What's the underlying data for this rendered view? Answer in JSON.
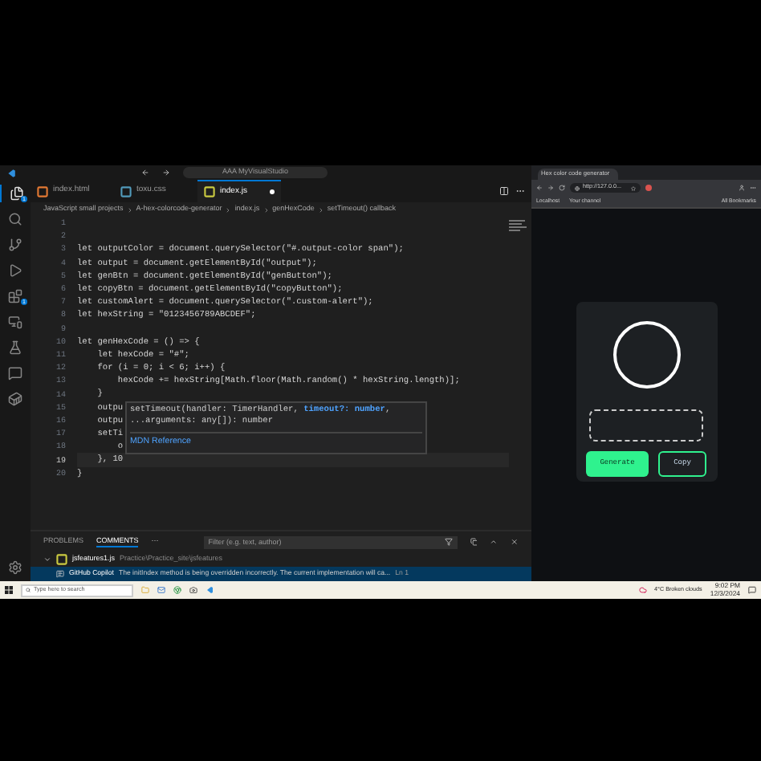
{
  "title_bar": {
    "search": "AAA MyVisualStudio"
  },
  "activity_bar": [
    {
      "kind": "files",
      "selected": true,
      "badge": "1"
    },
    {
      "kind": "search",
      "selected": false
    },
    {
      "kind": "source-control",
      "selected": false
    },
    {
      "kind": "run",
      "selected": false
    },
    {
      "kind": "extensions",
      "selected": false,
      "badge": "1"
    },
    {
      "kind": "remote",
      "selected": false
    },
    {
      "kind": "testing",
      "selected": false
    },
    {
      "kind": "chat",
      "selected": false
    },
    {
      "kind": "docker",
      "selected": false
    }
  ],
  "tabs": [
    {
      "label": "index.html",
      "kind": "html",
      "selected": false,
      "modified": false
    },
    {
      "label": "toxu.css",
      "kind": "css",
      "selected": false,
      "modified": false
    },
    {
      "label": "index.js",
      "kind": "js",
      "selected": true,
      "modified": true
    }
  ],
  "breadcrumb": [
    "JavaScript small projects",
    "A-hex-colorcode-generator",
    "index.js",
    "genHexCode",
    "setTimeout() callback"
  ],
  "code_lines": [
    {
      "number": "1"
    },
    {
      "number": "2"
    },
    {
      "number": "3",
      "text": "let outputColor = document.querySelector(\"#.output-color span\");"
    },
    {
      "number": "4",
      "text": "let output = document.getElementById(\"output\");"
    },
    {
      "number": "5",
      "text": "let genBtn = document.getElementById(\"genButton\");"
    },
    {
      "number": "6",
      "text": "let copyBtn = document.getElementById(\"copyButton\");"
    },
    {
      "number": "7",
      "text": "let customAlert = document.querySelector(\".custom-alert\");"
    },
    {
      "number": "8",
      "text": "let hexString = \"0123456789ABCDEF\";"
    },
    {
      "number": "9"
    },
    {
      "number": "10",
      "text": "let genHexCode = () => {"
    },
    {
      "number": "11",
      "text": "    let hexCode = \"#\";"
    },
    {
      "number": "12",
      "text": "    for (i = 0; i < 6; i++) {"
    },
    {
      "number": "13",
      "text": "        hexCode += hexString[Math.floor(Math.random() * hexString.length)];"
    },
    {
      "number": "14",
      "text": "    }"
    },
    {
      "number": "15",
      "text": "    outpu"
    },
    {
      "number": "16",
      "text": "    outpu"
    },
    {
      "number": "17",
      "text": "    setTi"
    },
    {
      "number": "18",
      "text": "        o"
    },
    {
      "number": "19",
      "text": "    }, 10"
    },
    {
      "number": "20",
      "text": "}"
    }
  ],
  "hover": {
    "signature": [
      {
        "text": "setTimeout(handler: TimerHandler, ",
        "kind": "plain"
      },
      {
        "text": "timeout?: number",
        "kind": "param"
      },
      {
        "text": ",",
        "kind": "plain"
      }
    ],
    "signature_end": "...arguments: any[]): number",
    "link": "MDN Reference"
  },
  "panel": {
    "tabs": [
      {
        "label": "PROBLEMS",
        "selected": false
      },
      {
        "label": "COMMENTS",
        "selected": true
      }
    ],
    "more": "···",
    "filter": {
      "placeholder": "Filter (e.g. text, author)"
    },
    "thread": {
      "file": "jsfeatures1.js",
      "path": "Practice\\Practice_site\\jsfeatures",
      "expanded": true
    },
    "comment": {
      "author": "GitHub Copilot",
      "text": "The initIndex method is being overridden incorrectly. The current implementation will ca...",
      "position": "Ln 1"
    }
  },
  "browser": {
    "tab_title": "Hex color code generator",
    "url": "http://127.0.0...",
    "bookmarks": [
      "Localhost",
      "Your channel"
    ],
    "all_bookmarks": "All Bookmarks",
    "buttons": [
      {
        "label": "Generate",
        "kind": "primary"
      },
      {
        "label": "Copy",
        "kind": "outline"
      }
    ]
  },
  "taskbar": {
    "search_placeholder": "Type here to search",
    "weather": "4°C Broken clouds",
    "time": "9:02 PM",
    "date": "12/3/2024"
  }
}
